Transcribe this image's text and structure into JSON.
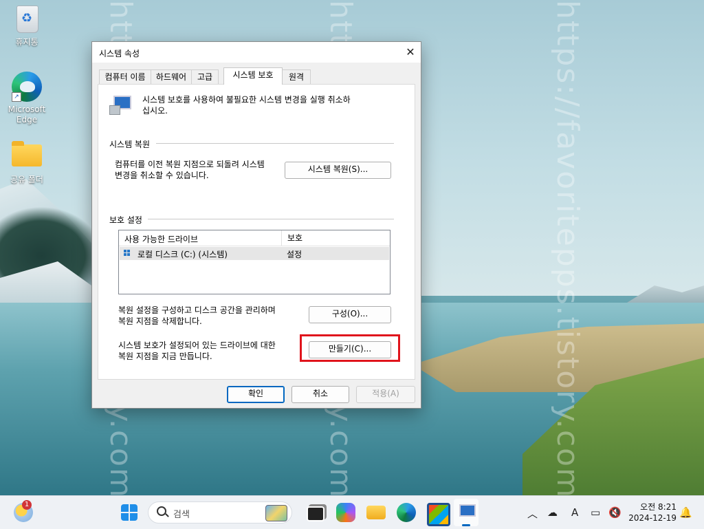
{
  "desktop": {
    "icons": [
      {
        "label": "휴지통"
      },
      {
        "label": "Microsoft Edge"
      },
      {
        "label": "공유 폴더"
      }
    ],
    "watermarks": [
      "https://favoritepps.tistory.com/",
      "https://favoritepps.tistory.com/",
      "https://favoritepps.tistory.com/"
    ]
  },
  "dialog": {
    "title": "시스템 속성",
    "close_glyph": "✕",
    "tabs": [
      {
        "label": "컴퓨터 이름",
        "active": false
      },
      {
        "label": "하드웨어",
        "active": false
      },
      {
        "label": "고급",
        "active": false
      },
      {
        "label": "시스템 보호",
        "active": true
      },
      {
        "label": "원격",
        "active": false
      }
    ],
    "intro_text_line1": "시스템 보호를 사용하여 불필요한 시스템 변경을 실행 취소하",
    "intro_text_line2": "십시오.",
    "restore": {
      "section_title": "시스템 복원",
      "desc_line1": "컴퓨터를 이전 복원 지점으로 되돌려 시스템",
      "desc_line2": "변경을 취소할 수 있습니다.",
      "button_label": "시스템 복원(S)..."
    },
    "protection": {
      "section_title": "보호 설정",
      "columns": [
        "사용 가능한 드라이브",
        "보호"
      ],
      "rows": [
        {
          "drive": "로컬 디스크 (C:) (시스템)",
          "status": "설정"
        }
      ],
      "configure_desc_line1": "복원 설정을 구성하고 디스크 공간을 관리하며",
      "configure_desc_line2": "복원 지점을 삭제합니다.",
      "configure_label": "구성(O)...",
      "create_desc_line1": "시스템 보호가 설정되어 있는 드라이브에 대한",
      "create_desc_line2": "복원 지점을 지금 만듭니다.",
      "create_label": "만들기(C)..."
    },
    "footer": {
      "ok_label": "확인",
      "cancel_label": "취소",
      "apply_label": "적용(A)"
    }
  },
  "taskbar": {
    "weather_badge": "1",
    "search_placeholder": "검색",
    "tray_ime": "A",
    "clock_time": "오전 8:21",
    "clock_date": "2024-12-19"
  },
  "colors": {
    "highlight_box": "#e0141c",
    "primary_border": "#0067c0"
  }
}
